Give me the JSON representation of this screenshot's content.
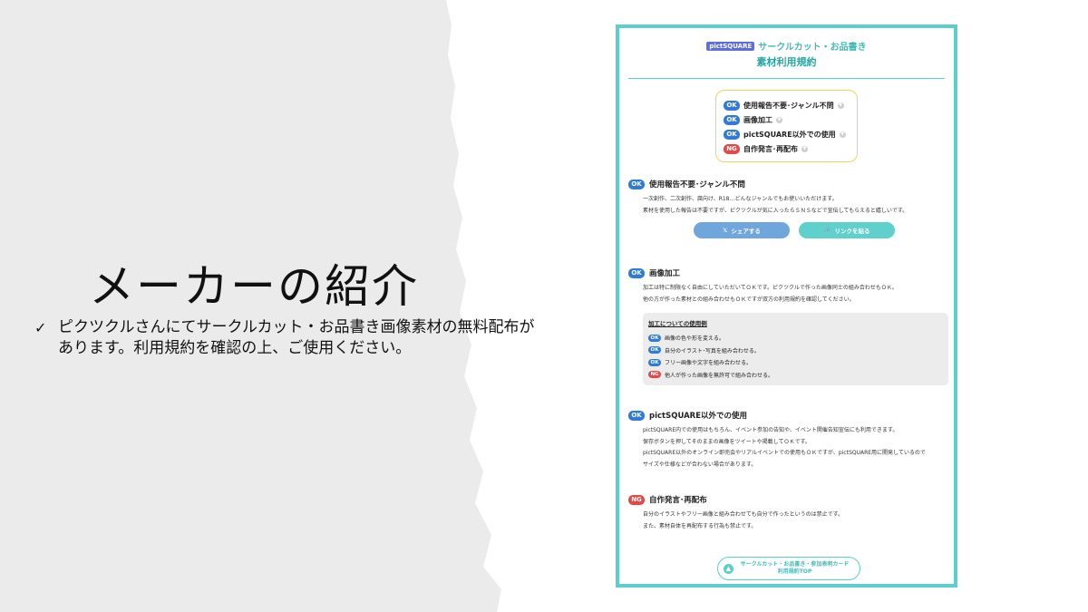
{
  "slide": {
    "title": "メーカーの紹介",
    "bullet_icon": "check-icon",
    "bullet_text": "ピクツクルさんにてサークルカット・お品書き画像素材の無料配布があります。利用規約を確認の上、ご使用ください。"
  },
  "doc": {
    "brand": "pictSQUARE",
    "subtitle": "サークルカット・お品書き",
    "title": "素材利用規約",
    "toc": [
      {
        "badge": "OK",
        "label": "使用報告不要･ジャンル不問"
      },
      {
        "badge": "OK",
        "label": "画像加工"
      },
      {
        "badge": "OK",
        "label": "pictSQUARE以外での使用"
      },
      {
        "badge": "NG",
        "label": "自作発言･再配布"
      }
    ],
    "sections": {
      "usage": {
        "badge": "OK",
        "title": "使用報告不要･ジャンル不問",
        "lines": [
          "一次創作、二次創作、腐向け、R18…どんなジャンルでもお使いいただけます。",
          "素材を使用した報告は不要ですが、ピクツクルが気に入ったらＳＮＳなどで宣伝してもらえると嬉しいです。"
        ],
        "share_label": "シェアする",
        "link_label": "リンクを貼る"
      },
      "edit": {
        "badge": "OK",
        "title": "画像加工",
        "lines": [
          "加工は特に制限なく自由にしていただいてＯＫです。ピクツクルで作った画像同士の組み合わせもＯＫ。",
          "他の方が作った素材との組み合わせもＯＫですが双方の利用規約を確認してください。"
        ],
        "example_title": "加工についての使用例",
        "examples": [
          {
            "badge": "OK",
            "text": "画像の色や形を変える。"
          },
          {
            "badge": "OK",
            "text": "自分のイラスト･写真を組み合わせる。"
          },
          {
            "badge": "OK",
            "text": "フリー画像や文字を組み合わせる。"
          },
          {
            "badge": "NG",
            "text": "他人が作った画像を無許可で組み合わせる。"
          }
        ]
      },
      "outside": {
        "badge": "OK",
        "title": "pictSQUARE以外での使用",
        "lines": [
          "pictSQUARE内での使用はもちろん、イベント参加の告知や、イベント開催告知宣伝にも利用できます。",
          "保存ボタンを押してそのままの画像をツイートや掲載してＯＫです。",
          "pictSQUARE以外のオンライン即売会やリアルイベントでの使用もＯＫですが、pictSQUARE用に開発しているので",
          "サイズや仕様などが合わない場合があります。"
        ]
      },
      "ng": {
        "badge": "NG",
        "title": "自作発言･再配布",
        "lines": [
          "自分のイラストやフリー画像と組み合わせても自分で作ったというのは禁止です。",
          "また、素材自体を再配布する行為も禁止です。"
        ]
      }
    },
    "back_line1": "サークルカット・お品書き・参加表明カード",
    "back_line2": "利用規約TOP"
  },
  "colors": {
    "accent": "#5bcfcb",
    "ok": "#2f7bd6",
    "ng": "#e24a4a",
    "toc_border": "#f0d460",
    "brand": "#5e6ee0"
  }
}
